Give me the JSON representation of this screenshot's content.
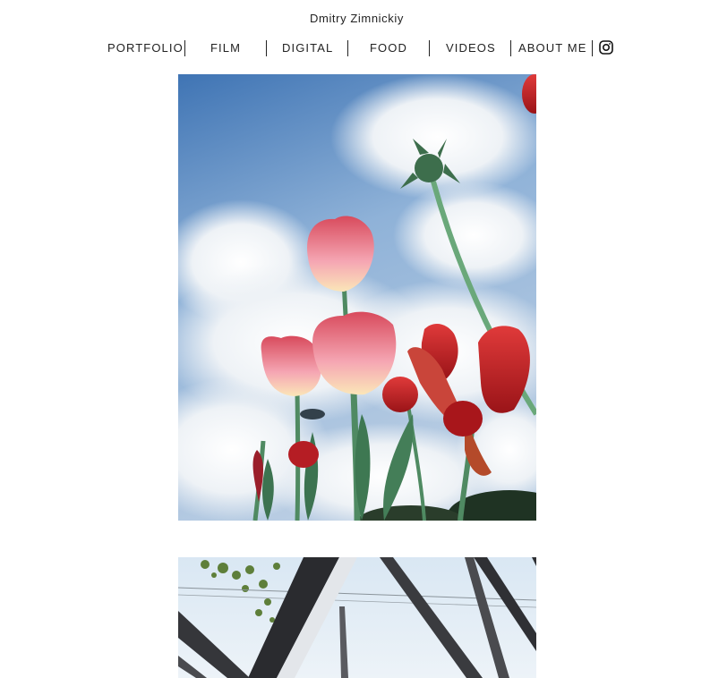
{
  "site": {
    "title": "Dmitry Zimnickiy"
  },
  "nav": {
    "items": [
      {
        "label": "PORTFOLIO"
      },
      {
        "label": "FILM"
      },
      {
        "label": "DIGITAL"
      },
      {
        "label": "FOOD"
      },
      {
        "label": "VIDEOS"
      },
      {
        "label": "ABOUT ME"
      }
    ],
    "social_icon": "instagram-icon"
  },
  "gallery": {
    "photos": [
      {
        "subject": "tulips-against-sky",
        "icon": "photo"
      },
      {
        "subject": "steel-structure-with-sky",
        "icon": "photo"
      }
    ]
  },
  "colors": {
    "text": "#222222",
    "background": "#ffffff",
    "sky": "#5a8bc4",
    "tulip_red": "#c7303a"
  }
}
